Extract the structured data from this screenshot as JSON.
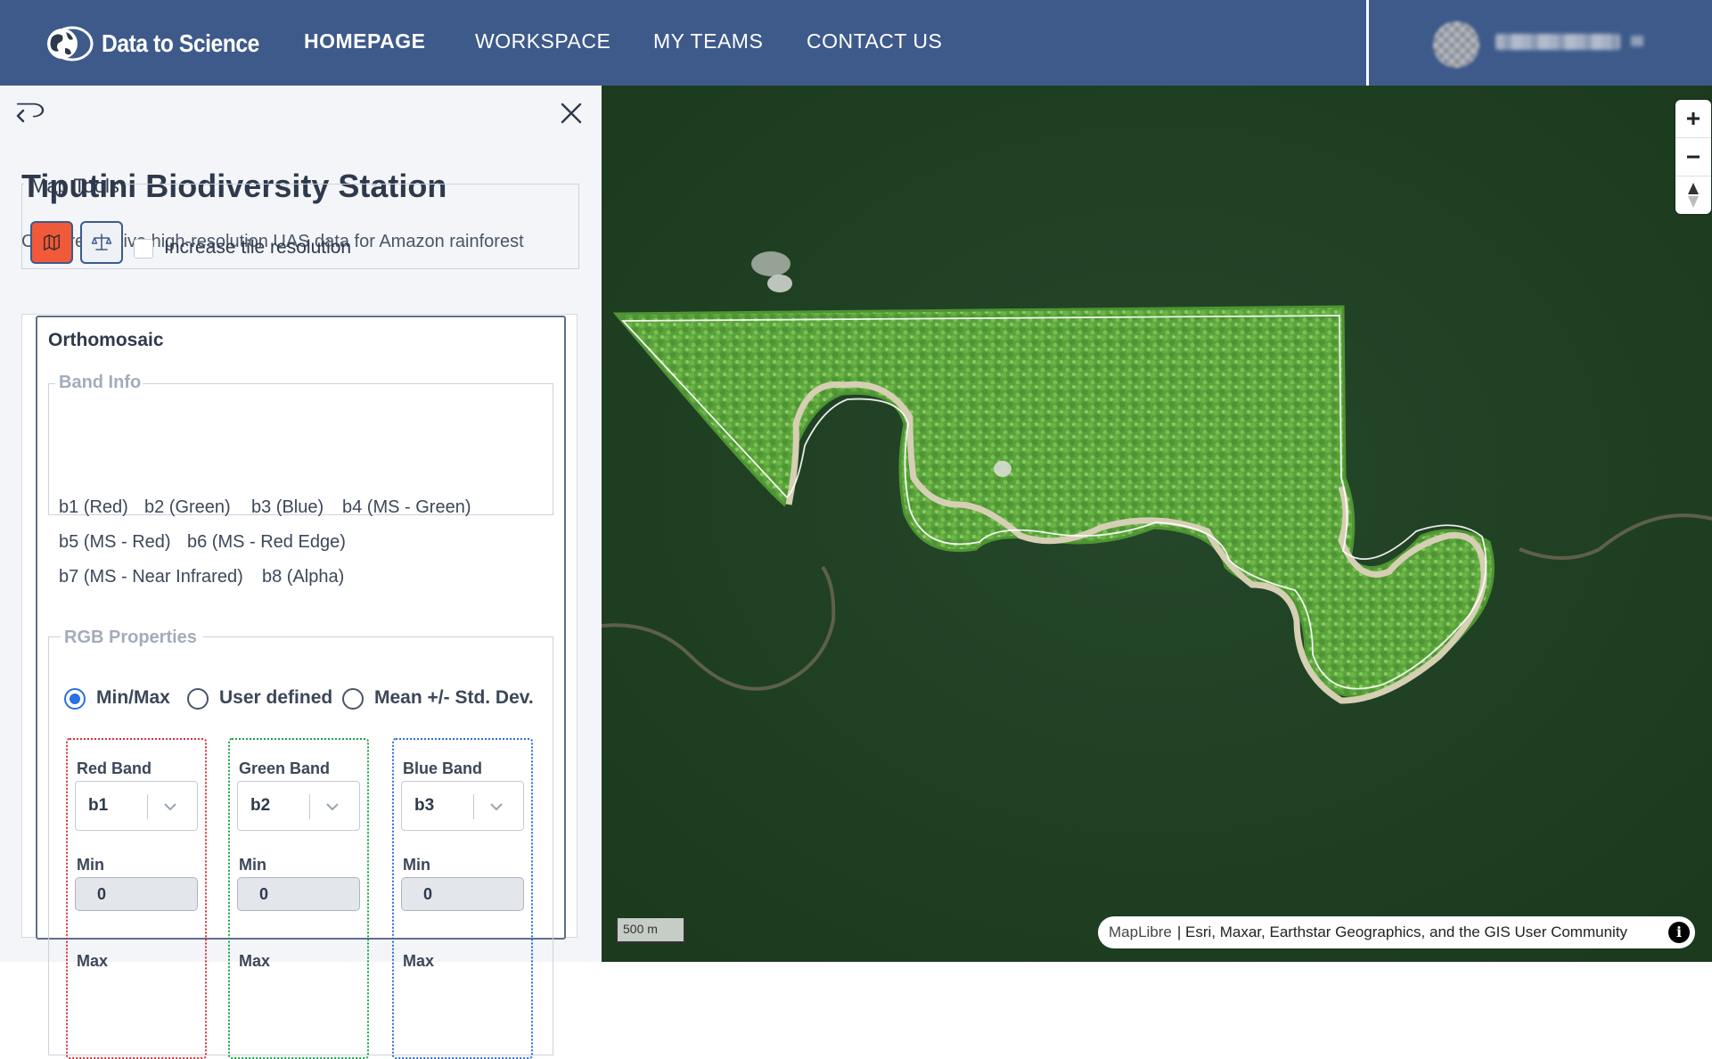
{
  "header": {
    "logo_text": "Data to Science",
    "nav": [
      {
        "label": "HOMEPAGE",
        "active": true
      },
      {
        "label": "WORKSPACE",
        "active": false
      },
      {
        "label": "MY TEAMS",
        "active": false
      },
      {
        "label": "CONTACT US",
        "active": false
      }
    ],
    "colors": {
      "nav_bg": "#3d5a8a"
    }
  },
  "sidebar": {
    "title": "Tiputini Biodiversity Station",
    "description": "Comprehensive high-resolution UAS data for Amazon rainforest",
    "map_tools": {
      "legend": "Map Tools",
      "tools": [
        {
          "icon": "map-icon",
          "active": true
        },
        {
          "icon": "scale-compare-icon",
          "active": false
        }
      ],
      "checkbox_label": "Increase tile resolution",
      "checkbox_checked": false
    },
    "orthomosaic": {
      "title": "Orthomosaic",
      "band_info": {
        "legend": "Band Info",
        "bands": [
          "b1 (Red)",
          "b2 (Green)",
          "b3 (Blue)",
          "b4 (MS - Green)",
          "b5 (MS - Red)",
          "b6 (MS - Red Edge)",
          "b7 (MS - Near Infrared)",
          "b8 (Alpha)"
        ]
      },
      "rgb_properties": {
        "legend": "RGB Properties",
        "modes": [
          {
            "label": "Min/Max",
            "checked": true
          },
          {
            "label": "User defined",
            "checked": false
          },
          {
            "label": "Mean +/- Std. Dev.",
            "checked": false
          }
        ],
        "bands": [
          {
            "label": "Red Band",
            "value": "b1",
            "min_label": "Min",
            "min": "0",
            "max_label": "Max",
            "color": "#d9323a"
          },
          {
            "label": "Green Band",
            "value": "b2",
            "min_label": "Min",
            "min": "0",
            "max_label": "Max",
            "color": "#19a24a"
          },
          {
            "label": "Blue Band",
            "value": "b3",
            "min_label": "Min",
            "min": "0",
            "max_label": "Max",
            "color": "#2b6fe0"
          }
        ]
      }
    },
    "colors": {
      "active_tool": "#f05a3a",
      "panel_bg": "#f3f5f9"
    }
  },
  "map": {
    "scale_label": "500 m",
    "attribution_link": "MapLibre",
    "attribution_text": "| Esri, Maxar, Earthstar Geographics, and the GIS User Community",
    "info_glyph": "i",
    "controls": [
      "zoom-in-icon",
      "zoom-out-icon",
      "compass-icon"
    ]
  }
}
